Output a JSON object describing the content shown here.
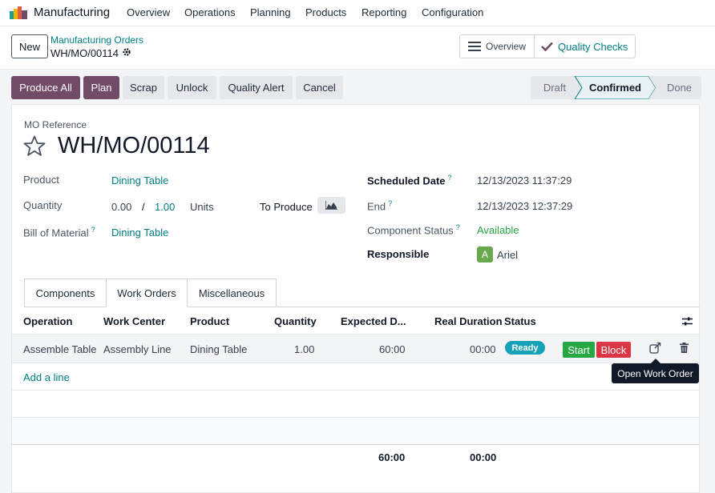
{
  "navbar": {
    "app_name": "Manufacturing",
    "menu": [
      "Overview",
      "Operations",
      "Planning",
      "Products",
      "Reporting",
      "Configuration"
    ]
  },
  "control": {
    "new_label": "New",
    "breadcrumb": "Manufacturing Orders",
    "record_name": "WH/MO/00114",
    "stat_overview": "Overview",
    "stat_quality": "Quality Checks"
  },
  "actions": [
    "Produce All",
    "Plan",
    "Scrap",
    "Unlock",
    "Quality Alert",
    "Cancel"
  ],
  "statusbar": {
    "steps": [
      "Draft",
      "Confirmed",
      "Done"
    ],
    "current": "Confirmed"
  },
  "form": {
    "ref_label": "MO Reference",
    "title": "WH/MO/00114",
    "product_label": "Product",
    "product_value": "Dining Table",
    "quantity_label": "Quantity",
    "qty_produced": "0.00",
    "qty_sep": "/",
    "qty_target": "1.00",
    "qty_uom": "Units",
    "to_produce_label": "To Produce",
    "bom_label": "Bill of Material",
    "bom_help": "?",
    "bom_value": "Dining Table",
    "scheduled_label": "Scheduled Date",
    "scheduled_help": "?",
    "scheduled_value": "12/13/2023 11:37:29",
    "end_label": "End",
    "end_help": "?",
    "end_value": "12/13/2023 12:37:29",
    "component_status_label": "Component Status",
    "component_status_help": "?",
    "component_status_value": "Available",
    "responsible_label": "Responsible",
    "responsible_initial": "A",
    "responsible_value": "Ariel"
  },
  "tabs": [
    "Components",
    "Work Orders",
    "Miscellaneous"
  ],
  "active_tab": "Work Orders",
  "table": {
    "columns": [
      "Operation",
      "Work Center",
      "Product",
      "Quantity",
      "Expected D...",
      "Real Duration",
      "Status"
    ],
    "rows": [
      {
        "operation": "Assemble Table",
        "work_center": "Assembly Line",
        "product": "Dining Table",
        "quantity": "1.00",
        "expected": "60:00",
        "real": "00:00",
        "status": "Ready",
        "start_label": "Start",
        "block_label": "Block"
      }
    ],
    "add_line": "Add a line",
    "tooltip": "Open Work Order",
    "total_expected": "60:00",
    "total_real": "00:00"
  },
  "colors": {
    "brand": "#714b67",
    "link": "#017e84",
    "ready": "#17a2b8",
    "start": "#28a745",
    "block": "#dc3545"
  }
}
